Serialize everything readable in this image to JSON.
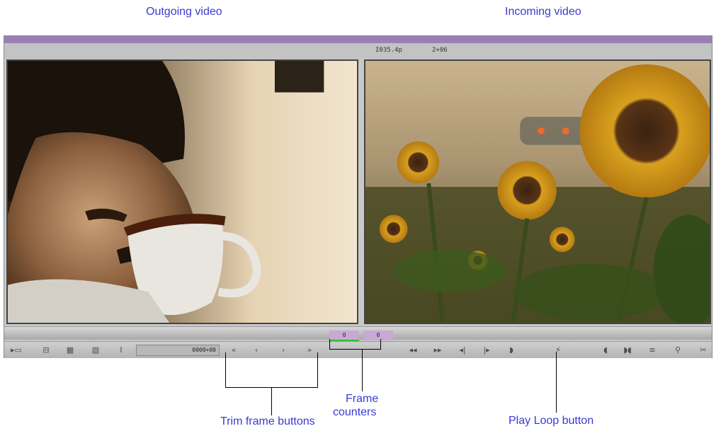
{
  "annotations": {
    "outgoing_label": "Outgoing video",
    "incoming_label": "Incoming video",
    "trim_label": "Trim frame buttons",
    "counter_label_line1": "Frame",
    "counter_label_line2": "counters",
    "play_loop_label": "Play Loop button"
  },
  "window": {
    "titlebar_color": "#9a7fb4",
    "timecode": "I035.4p",
    "duration": "2+06"
  },
  "counters": {
    "left_value": "0",
    "right_value": "0",
    "active_color": "#2ec12e"
  },
  "toolbar": {
    "timecode_field": "0000+00",
    "buttons": {
      "trim_left_10": "«",
      "trim_left_1": "‹",
      "trim_right_1": "›",
      "trim_right_10": "»",
      "rewind": "◂◂",
      "fast_forward": "▸▸",
      "step_back": "◂|",
      "step_forward": "|▸",
      "play_out": "◗",
      "play_loop": "⚡",
      "mark_in": "◖",
      "mark_both": "◗◖",
      "clip": "≡",
      "transition": "⚲",
      "remove": "✂"
    }
  }
}
